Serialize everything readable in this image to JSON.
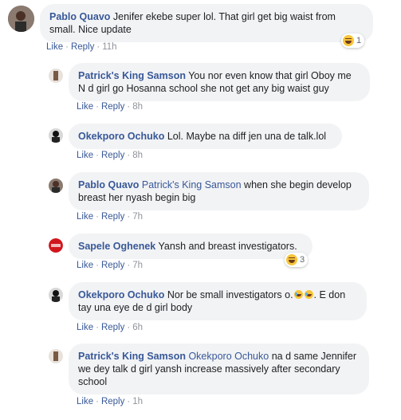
{
  "colors": {
    "link": "#385898",
    "meta": "#90949c",
    "bubble": "#f2f3f5"
  },
  "comments": [
    {
      "name": "Pablo Quavo",
      "text": "Jenifer ekebe super lol. That girl get big waist from small. Nice update",
      "like": "Like",
      "reply": "Reply",
      "time": "11h",
      "reaction": {
        "icon": "haha-emoji-icon",
        "count": "1"
      }
    },
    {
      "name": "Patrick's King Samson",
      "text": "You nor even know that girl Oboy me N d girl go Hosanna school she not get any big waist guy",
      "like": "Like",
      "reply": "Reply",
      "time": "8h"
    },
    {
      "name": "Okekporo Ochuko",
      "text": "Lol. Maybe na diff jen una de talk.lol",
      "like": "Like",
      "reply": "Reply",
      "time": "8h"
    },
    {
      "name": "Pablo Quavo",
      "mention": "Patrick's King Samson",
      "text": "when she begin develop breast her nyash begin big",
      "like": "Like",
      "reply": "Reply",
      "time": "7h"
    },
    {
      "name": "Sapele Oghenek",
      "text": "Yansh and breast investigators.",
      "like": "Like",
      "reply": "Reply",
      "time": "7h",
      "reaction": {
        "icon": "haha-emoji-icon",
        "count": "3"
      }
    },
    {
      "name": "Okekporo Ochuko",
      "text": "Nor be small investigators o.",
      "text2": ". E don tay una eye de d girl body",
      "like": "Like",
      "reply": "Reply",
      "time": "6h"
    },
    {
      "name": "Patrick's King Samson",
      "mention": "Okekporo Ochuko",
      "text": "na d same Jennifer we dey talk d girl yansh increase massively after secondary school",
      "like": "Like",
      "reply": "Reply",
      "time": "1h"
    }
  ]
}
